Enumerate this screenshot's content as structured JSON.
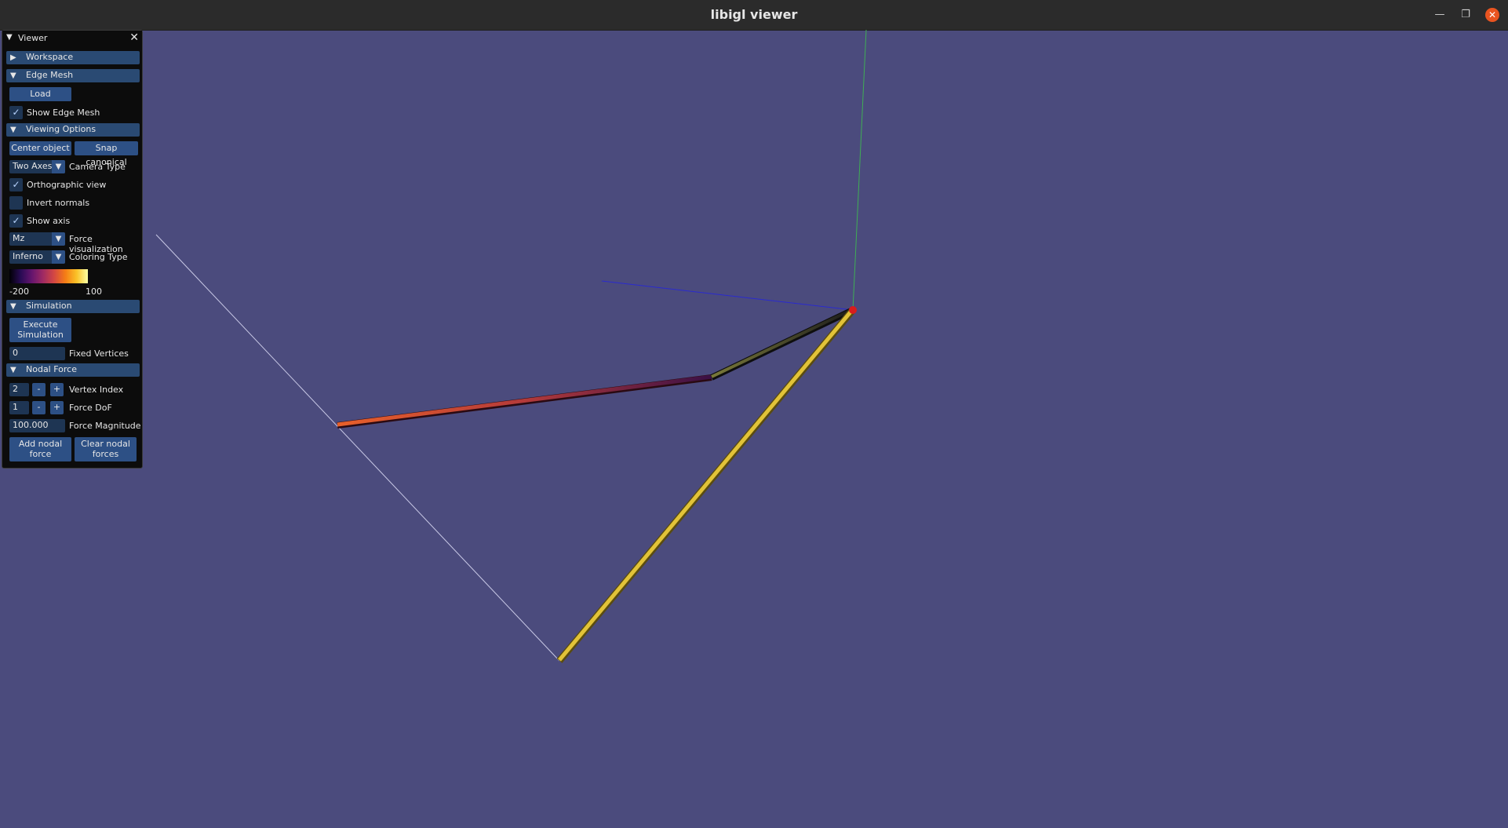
{
  "window": {
    "title": "libigl viewer",
    "minimize_icon": "minimize-icon",
    "maximize_icon": "maximize-icon",
    "close_icon": "close-icon"
  },
  "panel": {
    "title": "Viewer",
    "close_glyph": "✕",
    "sections": {
      "workspace": "Workspace",
      "edge_mesh": "Edge Mesh",
      "viewing_options": "Viewing Options",
      "simulation": "Simulation",
      "nodal_force": "Nodal Force"
    },
    "edge_mesh": {
      "load_label": "Load",
      "show_edge_mesh_label": "Show Edge Mesh",
      "show_edge_mesh_checked": true
    },
    "viewing": {
      "center_object_label": "Center object",
      "snap_canonical_label": "Snap canonical",
      "camera_type_value": "Two Axes",
      "camera_type_label": "Camera Type",
      "orthographic_label": "Orthographic view",
      "orthographic_checked": true,
      "invert_normals_label": "Invert normals",
      "invert_normals_checked": false,
      "show_axis_label": "Show axis",
      "show_axis_checked": true,
      "force_vis_value": "Mz",
      "force_vis_label": "Force visualization",
      "coloring_value": "Inferno",
      "coloring_label": "Coloring Type",
      "cmap_min": "-200",
      "cmap_max": "100"
    },
    "simulation": {
      "execute_label_1": "Execute",
      "execute_label_2": "Simulation",
      "fixed_vertices_value": "0",
      "fixed_vertices_label": "Fixed Vertices"
    },
    "nodal_force": {
      "vertex_index_value": "2",
      "vertex_index_label": "Vertex Index",
      "force_dof_value": "1",
      "force_dof_label": "Force DoF",
      "force_magnitude_value": "100.000",
      "force_magnitude_label": "Force Magnitude",
      "minus": "-",
      "plus": "+",
      "add_label_1": "Add nodal",
      "add_label_2": "force",
      "clear_label_1": "Clear nodal",
      "clear_label_2": "forces"
    }
  },
  "colors": {
    "background": "#4b4b7d",
    "header": "#2a4a73",
    "button": "#2d5085",
    "accent_close": "#e95420"
  }
}
